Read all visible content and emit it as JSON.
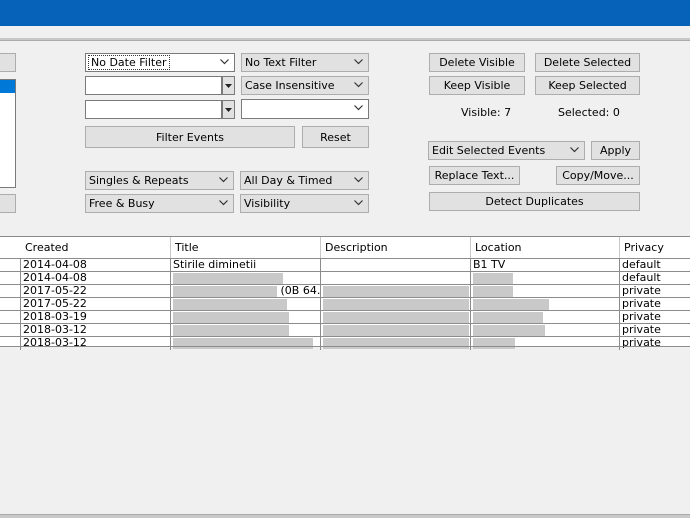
{
  "filters": {
    "date_filter": "No Date Filter",
    "text_filter": "No Text Filter",
    "case_mode": "Case Insensitive",
    "input1_value": "",
    "input2_value": "",
    "combo_empty": "",
    "filter_events_label": "Filter Events",
    "reset_label": "Reset",
    "repeat_filter": "Singles & Repeats",
    "allday_filter": "All Day & Timed",
    "busy_filter": "Free & Busy",
    "visibility_filter": "Visibility"
  },
  "actions": {
    "delete_visible": "Delete Visible",
    "delete_selected": "Delete Selected",
    "keep_visible": "Keep Visible",
    "keep_selected": "Keep Selected",
    "visible_count": "Visible: 7",
    "selected_count": "Selected: 0",
    "edit_selected": "Edit Selected Events",
    "apply": "Apply",
    "replace_text": "Replace Text...",
    "copy_move": "Copy/Move...",
    "detect_duplicates": "Detect Duplicates"
  },
  "table": {
    "columns": [
      "Created",
      "Title",
      "Description",
      "Location",
      "Privacy"
    ],
    "rows": [
      {
        "created": "2014-04-08",
        "title": "Stirile diminetii",
        "title_suffix": "",
        "description": "",
        "location": "B1 TV",
        "privacy": "default"
      },
      {
        "created": "2014-04-08",
        "title": "",
        "title_suffix": "",
        "description": "",
        "location": "",
        "privacy": "default"
      },
      {
        "created": "2017-05-22",
        "title": "",
        "title_suffix": "(0B 64...",
        "description": "",
        "location": "",
        "privacy": "private"
      },
      {
        "created": "2017-05-22",
        "title": "",
        "title_suffix": "",
        "description": "",
        "location": "",
        "privacy": "private"
      },
      {
        "created": "2018-03-19",
        "title": "",
        "title_suffix": "",
        "description": "",
        "location": "",
        "privacy": "private"
      },
      {
        "created": "2018-03-12",
        "title": "",
        "title_suffix": "",
        "description": "",
        "location": "",
        "privacy": "private"
      },
      {
        "created": "2018-03-12",
        "title": "",
        "title_suffix": "",
        "description": "",
        "location": "",
        "privacy": "private"
      }
    ]
  },
  "icons": {
    "dropdown": "chevron-down-icon",
    "dropdown_solid": "triangle-down-icon"
  },
  "colors": {
    "titlebar": "#0562b8",
    "selection": "#0078d7"
  }
}
